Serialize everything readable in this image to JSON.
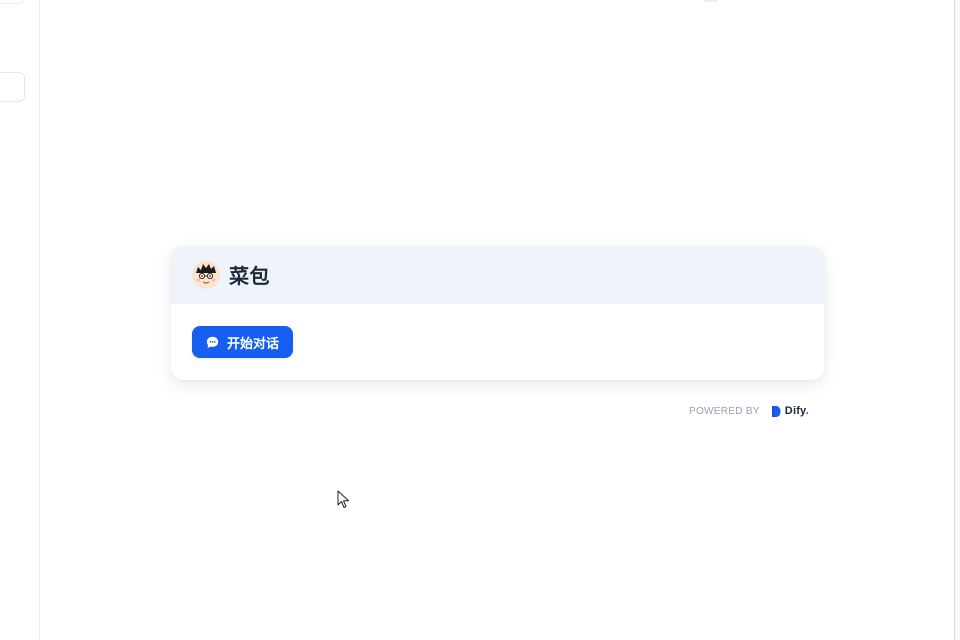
{
  "app": {
    "title": "菜包"
  },
  "actions": {
    "start_chat_label": "开始对话"
  },
  "footer": {
    "powered_by_label": "POWERED BY",
    "brand_name": "Dify",
    "brand_suffix": "."
  },
  "icons": {
    "avatar": "avatar-cartoon-face",
    "start_chat": "chat-bubble-icon",
    "brand": "dify-logo-icon",
    "cursor": "mouse-pointer"
  },
  "colors": {
    "accent": "#155eef",
    "header_bg": "#eff4fb",
    "title_text": "#1d2939",
    "muted_text": "#98a2b3"
  }
}
